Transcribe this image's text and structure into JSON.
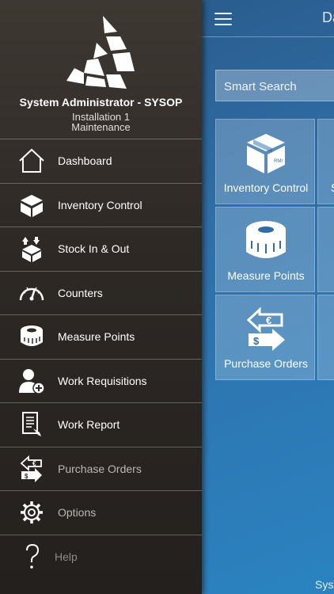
{
  "header": {
    "title": "Dashboard"
  },
  "search": {
    "placeholder": "Smart Search"
  },
  "profile": {
    "user": "System Administrator - SYSOP",
    "installation": "Installation 1",
    "role": "Maintenance"
  },
  "menu": {
    "items": [
      {
        "label": "Dashboard",
        "icon": "home-icon"
      },
      {
        "label": "Inventory Control",
        "icon": "box-icon"
      },
      {
        "label": "Stock In & Out",
        "icon": "stock-icon"
      },
      {
        "label": "Counters",
        "icon": "gauge-icon"
      },
      {
        "label": "Measure Points",
        "icon": "measuring-tape-icon"
      },
      {
        "label": "Work Requisitions",
        "icon": "user-add-icon"
      },
      {
        "label": "Work Report",
        "icon": "report-icon"
      },
      {
        "label": "Purchase Orders",
        "icon": "currency-exchange-icon"
      },
      {
        "label": "Options",
        "icon": "gear-icon"
      },
      {
        "label": "Help",
        "icon": "question-icon"
      }
    ]
  },
  "tiles": [
    {
      "label": "Inventory Control",
      "icon": "box-icon"
    },
    {
      "label": "Measure Points",
      "icon": "measuring-tape-icon"
    },
    {
      "label": "Purchase Orders",
      "icon": "currency-exchange-icon"
    }
  ],
  "tile_edges": [
    {
      "label": "S"
    },
    {
      "label": ""
    },
    {
      "label": ""
    }
  ],
  "footer": {
    "text": "System"
  }
}
